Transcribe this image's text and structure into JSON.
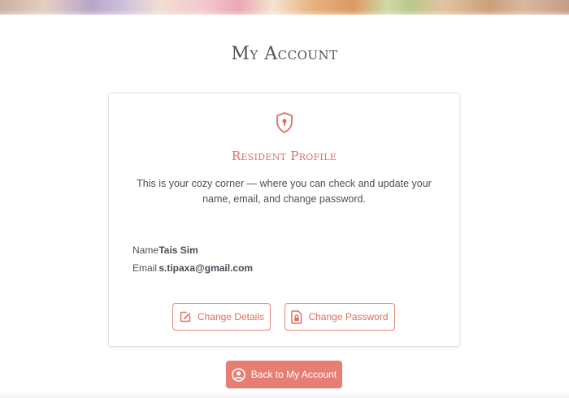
{
  "page": {
    "title": "My Account"
  },
  "card": {
    "title": "Resident Profile",
    "description": "This is your cozy corner — where you can check and update your name, email, and change password.",
    "fields": {
      "name_label": "Name",
      "name_value": "Tais Sim",
      "email_label": "Email",
      "email_value": "s.tipaxa@gmail.com"
    },
    "buttons": {
      "change_details": "Change Details",
      "change_password": "Change Password"
    }
  },
  "footer": {
    "back_button": "Back to My Account"
  },
  "icons": {
    "header": "shield-keyhole-icon",
    "details": "edit-icon",
    "password": "lock-file-icon",
    "back": "user-circle-icon"
  },
  "colors": {
    "accent": "#e06e61",
    "primary_button": "#e77e73"
  }
}
